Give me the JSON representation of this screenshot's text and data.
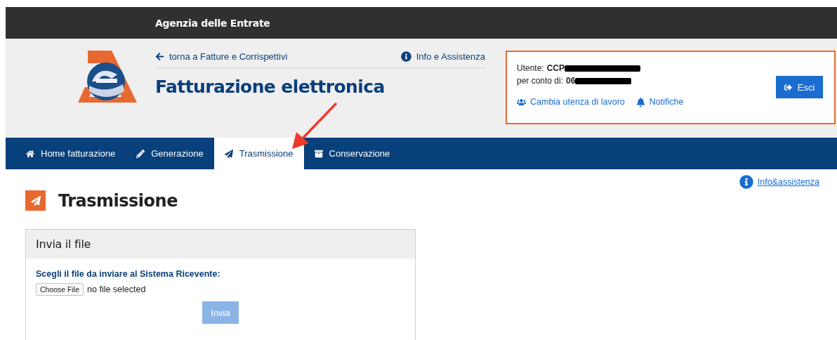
{
  "top_bar": {
    "title": "Agenzia delle Entrate"
  },
  "header": {
    "back_link": "torna a Fatture e Corrispettivi",
    "info_link": "Info e Assistenza",
    "title": "Fatturazione elettronica"
  },
  "user_box": {
    "user_label": "Utente:",
    "user_value": "CCP",
    "account_label": "per conto di:",
    "account_value": "06",
    "switch_link": "Cambia utenza di lavoro",
    "notifications_link": "Notifiche",
    "logout_button": "Esci"
  },
  "nav": {
    "tabs": [
      {
        "label": "Home fatturazione",
        "selected": false
      },
      {
        "label": "Generazione",
        "selected": false
      },
      {
        "label": "Trasmissione",
        "selected": true
      },
      {
        "label": "Conservazione",
        "selected": false
      }
    ]
  },
  "page": {
    "help_link": "Info&assistenza",
    "title": "Trasmissione",
    "panel": {
      "title": "Invia il file",
      "field_label": "Scegli il file da inviare al Sistema Ricevente:",
      "file_button": "Choose File",
      "file_status": "no file selected",
      "submit_button": {
        "label": "Invia",
        "disabled": true
      }
    }
  }
}
